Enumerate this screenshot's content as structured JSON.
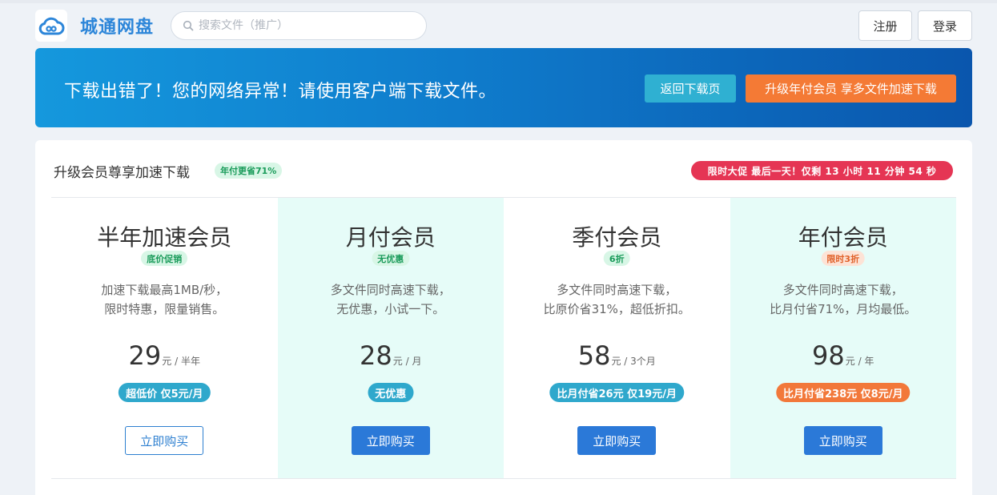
{
  "header": {
    "brand": "城通网盘",
    "search_placeholder": "搜索文件（推广）",
    "register_label": "注册",
    "login_label": "登录"
  },
  "banner": {
    "message": "下载出错了！您的网络异常！请使用客户端下载文件。",
    "back_label": "返回下载页",
    "upgrade_label": "升级年付会员 享多文件加速下载"
  },
  "membership": {
    "title": "升级会员尊享加速下载",
    "save_tag": "年付更省71%",
    "promo": "限时大促 最后一天！仅剩 13 小时 11 分钟 54 秒",
    "plans": [
      {
        "name": "半年加速会员",
        "tag": "底价促销",
        "desc_line1": "加速下载最高1MB/秒，",
        "desc_line2": "限时特惠，限量销售。",
        "price": "29",
        "unit": "元 / 半年",
        "deal": "超低价 仅5元/月",
        "buy_label": "立即购买"
      },
      {
        "name": "月付会员",
        "tag": "无优惠",
        "desc_line1": "多文件同时高速下载，",
        "desc_line2": "无优惠，小试一下。",
        "price": "28",
        "unit": "元 / 月",
        "deal": "无优惠",
        "buy_label": "立即购买"
      },
      {
        "name": "季付会员",
        "tag": "6折",
        "desc_line1": "多文件同时高速下载，",
        "desc_line2": "比原价省31%，超低折扣。",
        "price": "58",
        "unit": "元 / 3个月",
        "deal": "比月付省26元 仅19元/月",
        "buy_label": "立即购买"
      },
      {
        "name": "年付会员",
        "tag": "限时3折",
        "desc_line1": "多文件同时高速下载，",
        "desc_line2": "比月付省71%，月均最低。",
        "price": "98",
        "unit": "元 / 年",
        "deal": "比月付省238元 仅8元/月",
        "buy_label": "立即购买"
      }
    ]
  },
  "icons": {
    "logo": "cloud-logo-icon",
    "search": "search-icon"
  },
  "colors": {
    "brand": "#2d86d9",
    "banner_start": "#1598dd",
    "banner_end": "#0a56ad",
    "upgrade": "#f47a35",
    "back": "#2fb0d2",
    "promo": "#e53554",
    "buy": "#2b79d8",
    "tint": "#e6fcf8"
  }
}
